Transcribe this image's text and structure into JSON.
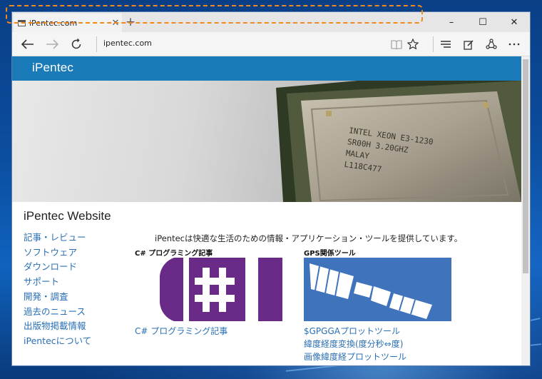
{
  "browser": {
    "tab_title": "iPentec.com",
    "new_tab_glyph": "+",
    "address": "ipentec.com",
    "toolbar_icons": [
      "back-icon",
      "forward-icon",
      "refresh-icon",
      "reading-view-icon",
      "favorite-star-icon",
      "hub-icon",
      "web-note-icon",
      "share-icon",
      "more-icon"
    ]
  },
  "window_controls": {
    "minimize": "–",
    "maximize": "☐",
    "close": "✕"
  },
  "highlight_color": "#f08a1e",
  "site": {
    "logo": "iPentec",
    "header_color": "#1b7ab8",
    "title": "iPentec Website",
    "tagline": "iPentecは快適な生活のための情報・アプリケーション・ツールを提供しています。",
    "hero_chip_text": [
      "INTEL XEON E3-1230",
      "SR00H 3.20GHZ",
      "MALAY",
      "L118C477"
    ],
    "nav": [
      "記事・レビュー",
      "ソフトウェア",
      "ダウンロード",
      "サポート",
      "開発・調査",
      "過去のニュース",
      "出版物掲載情報",
      "iPentecについて"
    ],
    "sections": {
      "csharp": {
        "heading": "C# プログラミング記事",
        "link": "C# プログラミング記事",
        "image_color": "#6a2a87"
      },
      "gps": {
        "heading": "GPS関係ツール",
        "links": [
          "$GPGGAプロットツール",
          "緯度経度変換(度分秒⇔度)",
          "画像緯度経プロットツール"
        ],
        "image_color": "#3f73bc"
      }
    }
  }
}
